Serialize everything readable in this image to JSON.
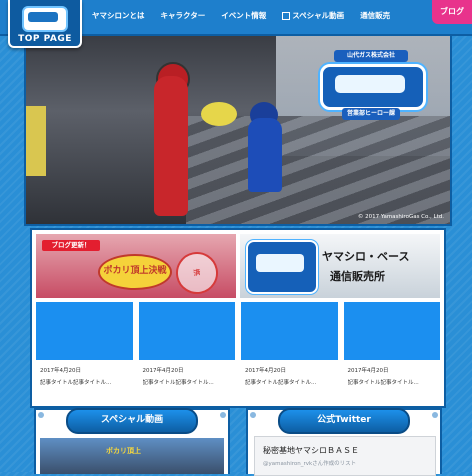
{
  "header": {
    "logo_label": "TOP PAGE",
    "nav": [
      "ヤマシロンとは",
      "キャラクター",
      "イベント情報",
      "スペシャル動画",
      "通信販売"
    ],
    "blog_tab": "ブログ"
  },
  "hero": {
    "logo_top": "山代ガス株式会社",
    "logo_sub": "営業部ヒーロー課",
    "copyright": "© 2017 YamashiroGas Co., Ltd."
  },
  "blog_banner": {
    "badge": "ブログ更新！",
    "title": "ポカリ頂上決戦",
    "stamp": "済"
  },
  "shop_banner": {
    "line1": "ヤマシロ・ベース",
    "line2": "通信販売所"
  },
  "posts": [
    {
      "date": "2017年4月20日",
      "title": "記事タイトル記事タイトル..."
    },
    {
      "date": "2017年4月20日",
      "title": "記事タイトル記事タイトル..."
    },
    {
      "date": "2017年4月20日",
      "title": "記事タイトル記事タイトル..."
    },
    {
      "date": "2017年4月20日",
      "title": "記事タイトル記事タイトル..."
    }
  ],
  "special": {
    "heading": "スペシャル動画",
    "thumb_text": "ポカリ頂上"
  },
  "twitter": {
    "heading": "公式Twitter",
    "title": "秘密基地ヤマシロＢＡＳＥ",
    "sub": "@yamashiron_rvkさん作成のリスト"
  },
  "colors": {
    "background": "#2a8fd6",
    "blog_tab": "#e8338c",
    "post_thumb": "#1b8ff0"
  }
}
